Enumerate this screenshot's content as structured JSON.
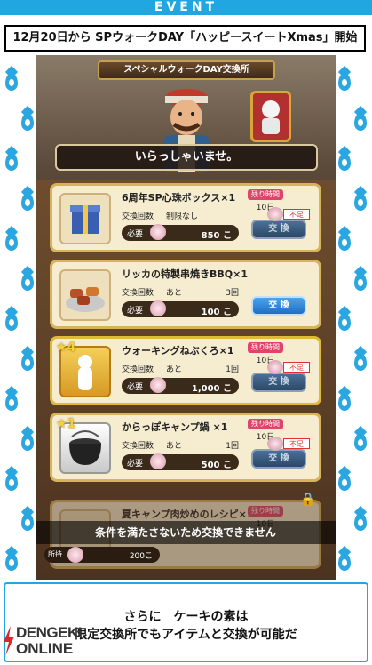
{
  "banner": {
    "event_label": "EVENT"
  },
  "headline": "12月20日から SPウォークDAY「ハッピースイートXmas」開始",
  "colors": {
    "accent": "#22a6e2",
    "buy_button": "#2f86d8",
    "time_badge": "#e0446a",
    "lack": "#d33333"
  },
  "shop": {
    "title": "スペシャルウォークDAY交換所",
    "greeting": "いらっしゃいませ。"
  },
  "items": [
    {
      "name": "6周年SP心珠ボックス×1",
      "exchange_label": "交換回数",
      "limit": "制限なし",
      "count": "",
      "need_label": "必要",
      "price": "850 こ",
      "time_label": "残り時間",
      "time": "10日",
      "lack": "不足",
      "button": "交 換",
      "icon": "gift-box-icon"
    },
    {
      "name": "リッカの特製串焼きBBQ×1",
      "exchange_label": "交換回数",
      "limit": "あと",
      "count": "3回",
      "need_label": "必要",
      "price": "100 こ",
      "time_label": "",
      "time": "",
      "lack": "",
      "button": "交 換",
      "icon": "skewer-icon"
    },
    {
      "name": "ウォーキングねぶくろ×1",
      "exchange_label": "交換回数",
      "limit": "あと",
      "count": "1回",
      "need_label": "必要",
      "price": "1,000 こ",
      "time_label": "残り時間",
      "time": "10日",
      "lack": "不足",
      "button": "交 換",
      "icon": "sleeping-bag-icon",
      "stars": "4"
    },
    {
      "name": "からっぽキャンプ鍋  ×1",
      "exchange_label": "交換回数",
      "limit": "あと",
      "count": "1回",
      "need_label": "必要",
      "price": "500 こ",
      "time_label": "残り時間",
      "time": "10日",
      "lack": "不足",
      "button": "交 換",
      "icon": "pot-icon",
      "stars": "1"
    },
    {
      "name": "夏キャンプ肉炒めのレシピ×1",
      "exchange_label": "",
      "limit": "",
      "count": "",
      "need_label": "",
      "price": "",
      "time_label": "残り時間",
      "time": "10日",
      "lack": "",
      "button": "",
      "icon": "recipe-icon"
    }
  ],
  "warning": "条件を満たさないため交換できません",
  "owned": {
    "label": "所持",
    "value": "200こ"
  },
  "caption": {
    "line1": "さらに　ケーキの素は",
    "line2": "限定交換所でもアイテムと交換が可能だ"
  },
  "logo": {
    "main": "DENGEKI",
    "sub": "ONLINE"
  }
}
